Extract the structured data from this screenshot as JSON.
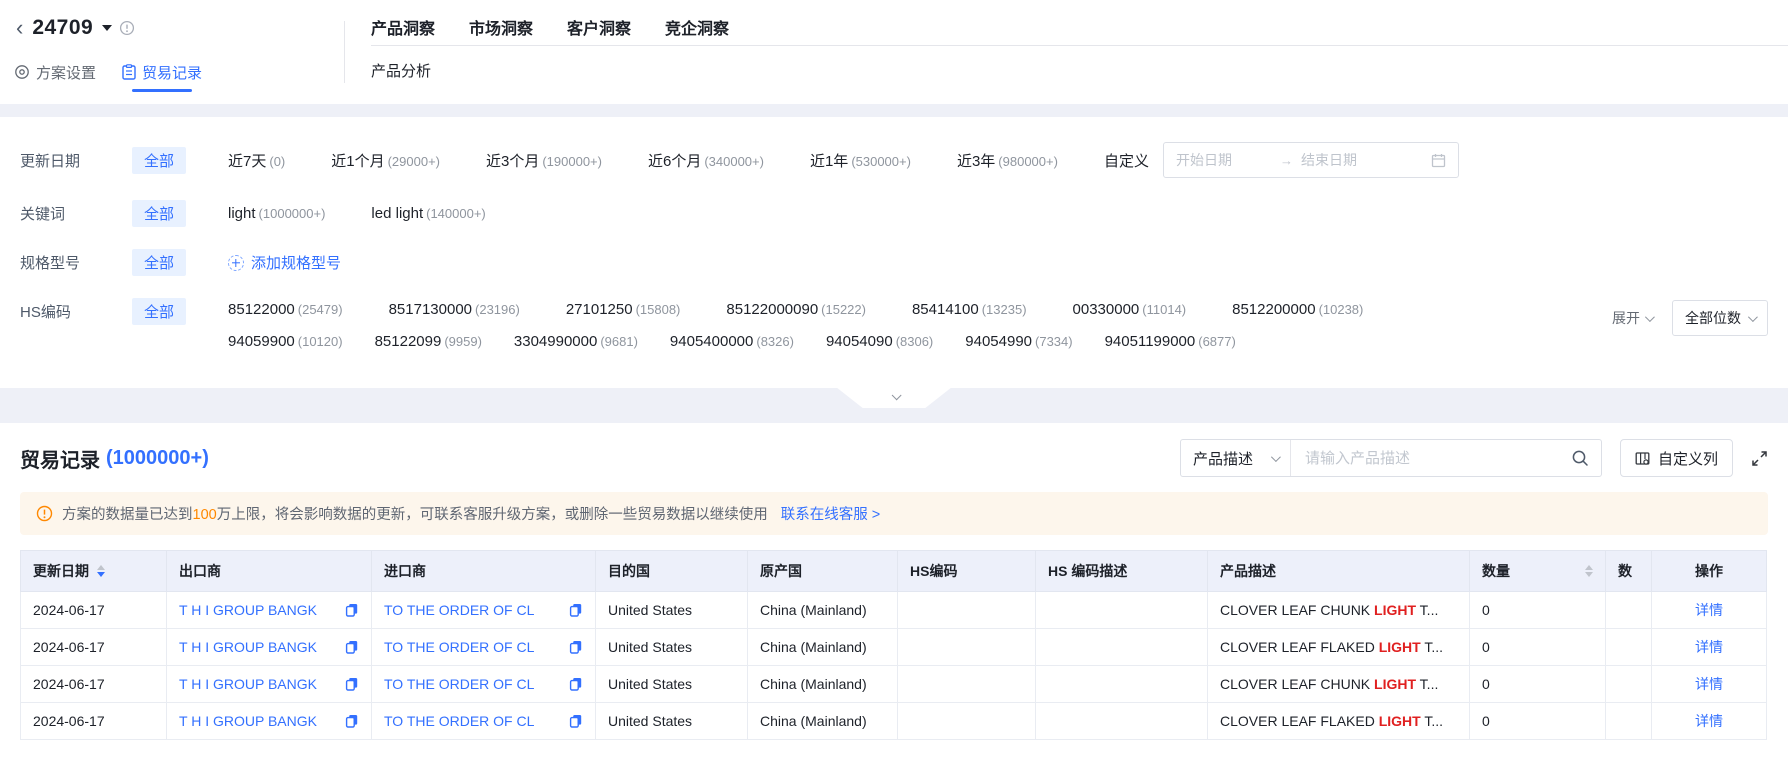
{
  "header": {
    "plan_id": "24709",
    "tabs": [
      "产品洞察",
      "市场洞察",
      "客户洞察",
      "竞企洞察"
    ],
    "plan_settings": "方案设置",
    "trade_records": "贸易记录",
    "product_analysis": "产品分析"
  },
  "filters": {
    "update": {
      "label": "更新日期",
      "all": "全部",
      "opts": [
        {
          "t": "近7天",
          "c": "(0)"
        },
        {
          "t": "近1个月",
          "c": "(29000+)"
        },
        {
          "t": "近3个月",
          "c": "(190000+)"
        },
        {
          "t": "近6个月",
          "c": "(340000+)"
        },
        {
          "t": "近1年",
          "c": "(530000+)"
        },
        {
          "t": "近3年",
          "c": "(980000+)"
        }
      ],
      "custom": "自定义",
      "start_placeholder": "开始日期",
      "arrow": "→",
      "end_placeholder": "结束日期"
    },
    "keyword": {
      "label": "关键词",
      "all": "全部",
      "opts": [
        {
          "t": "light",
          "c": "(1000000+)"
        },
        {
          "t": "led light",
          "c": "(140000+)"
        }
      ]
    },
    "spec": {
      "label": "规格型号",
      "all": "全部",
      "add": "添加规格型号"
    },
    "hs": {
      "label": "HS编码",
      "all": "全部",
      "row1": [
        {
          "t": "85122000",
          "c": "(25479)"
        },
        {
          "t": "8517130000",
          "c": "(23196)"
        },
        {
          "t": "27101250",
          "c": "(15808)"
        },
        {
          "t": "85122000090",
          "c": "(15222)"
        },
        {
          "t": "85414100",
          "c": "(13235)"
        },
        {
          "t": "00330000",
          "c": "(11014)"
        },
        {
          "t": "8512200000",
          "c": "(10238)"
        }
      ],
      "row2": [
        {
          "t": "94059900",
          "c": "(10120)"
        },
        {
          "t": "85122099",
          "c": "(9959)"
        },
        {
          "t": "3304990000",
          "c": "(9681)"
        },
        {
          "t": "9405400000",
          "c": "(8326)"
        },
        {
          "t": "94054090",
          "c": "(8306)"
        },
        {
          "t": "94054990",
          "c": "(7334)"
        },
        {
          "t": "94051199000",
          "c": "(6877)"
        }
      ],
      "expand": "展开",
      "digits": "全部位数"
    }
  },
  "records": {
    "title": "贸易记录",
    "count": "(1000000+)",
    "search_type": "产品描述",
    "search_placeholder": "请输入产品描述",
    "custom_cols": "自定义列"
  },
  "banner": {
    "pre": "方案的数据量已达到",
    "num": "100",
    "post": "万上限，将会影响数据的更新，可联系客服升级方案，或删除一些贸易数据以继续使用",
    "link": "联系在线客服 >"
  },
  "table": {
    "headers": {
      "date": "更新日期",
      "exporter": "出口商",
      "importer": "进口商",
      "dest": "目的国",
      "origin": "原产国",
      "hs": "HS编码",
      "hs_desc": "HS 编码描述",
      "product": "产品描述",
      "qty": "数量",
      "qty2": "数",
      "action": "操作"
    },
    "rows": [
      {
        "date": "2024-06-17",
        "exporter": "T H I GROUP BANGK",
        "importer": "TO THE ORDER OF CL",
        "dest": "United States",
        "origin": "China (Mainland)",
        "p1": "CLOVER LEAF CHUNK ",
        "hl": "LIGHT",
        "p2": " T...",
        "qty": "0",
        "action": "详情"
      },
      {
        "date": "2024-06-17",
        "exporter": "T H I GROUP BANGK",
        "importer": "TO THE ORDER OF CL",
        "dest": "United States",
        "origin": "China (Mainland)",
        "p1": "CLOVER LEAF FLAKED ",
        "hl": "LIGHT",
        "p2": " T...",
        "qty": "0",
        "action": "详情"
      },
      {
        "date": "2024-06-17",
        "exporter": "T H I GROUP BANGK",
        "importer": "TO THE ORDER OF CL",
        "dest": "United States",
        "origin": "China (Mainland)",
        "p1": "CLOVER LEAF CHUNK ",
        "hl": "LIGHT",
        "p2": " T...",
        "qty": "0",
        "action": "详情"
      },
      {
        "date": "2024-06-17",
        "exporter": "T H I GROUP BANGK",
        "importer": "TO THE ORDER OF CL",
        "dest": "United States",
        "origin": "China (Mainland)",
        "p1": "CLOVER LEAF FLAKED ",
        "hl": "LIGHT",
        "p2": " T...",
        "qty": "0",
        "action": "详情"
      }
    ]
  },
  "colors": {
    "accent": "#3370ff",
    "chip_bg": "#e8f1ff",
    "warning_orange": "#ff8800",
    "banner_bg": "#fdf6ec",
    "highlight_red": "#e02020",
    "table_header_bg": "#edf0fa"
  }
}
